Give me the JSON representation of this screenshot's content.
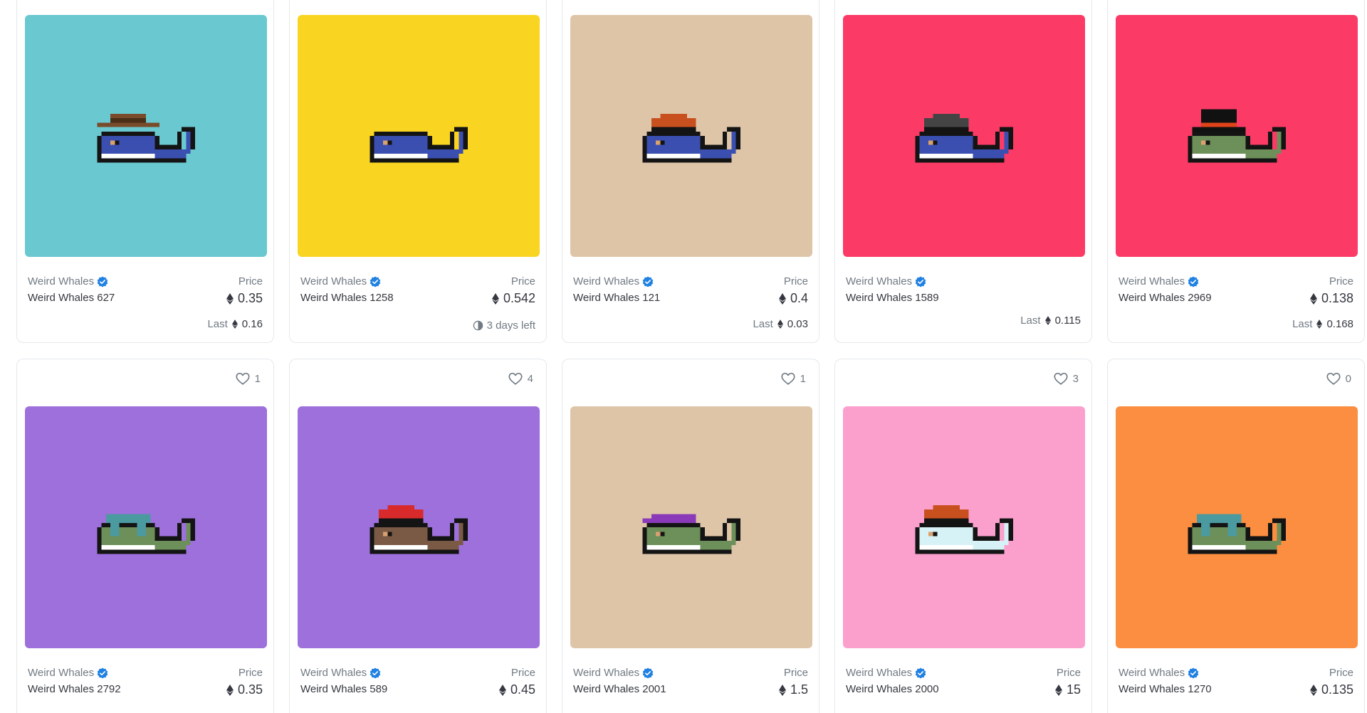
{
  "cards": [
    {
      "collection": "Weird Whales",
      "name": "Weird Whales 627",
      "price_label": "Price",
      "price": "0.35",
      "last_label": "Last",
      "last": "0.16",
      "bg": "#6ac8d0",
      "body": "#3a4fb0",
      "hat": "cowboy",
      "hat_color": "#7a4b2a"
    },
    {
      "collection": "Weird Whales",
      "name": "Weird Whales 1258",
      "price_label": "Price",
      "price": "0.542",
      "timer": "3 days left",
      "bg": "#f9d522",
      "body": "#3a4fb0",
      "hat": "none"
    },
    {
      "collection": "Weird Whales",
      "name": "Weird Whales 121",
      "price_label": "Price",
      "price": "0.4",
      "last_label": "Last",
      "last": "0.03",
      "bg": "#dec5a8",
      "body": "#3a4fb0",
      "hat": "beanie",
      "hat_color": "#c8501e"
    },
    {
      "collection": "Weird Whales",
      "name": "Weird Whales 1589",
      "price_label": "Price",
      "price": "",
      "last_label": "Last",
      "last": "0.115",
      "bg": "#fb3b66",
      "body": "#3a4fb0",
      "hat": "beanie",
      "hat_color": "#444444"
    },
    {
      "collection": "Weird Whales",
      "name": "Weird Whales 2969",
      "price_label": "Price",
      "price": "0.138",
      "last_label": "Last",
      "last": "0.168",
      "bg": "#fb3b66",
      "body": "#6d8f5a",
      "hat": "tophat",
      "hat_color": "#111111"
    },
    {
      "collection": "Weird Whales",
      "name": "Weird Whales 2792",
      "price_label": "Price",
      "price": "0.35",
      "likes": "1",
      "bg": "#9d70dc",
      "body": "#6d8f5a",
      "hat": "goggles",
      "hat_color": "#4a9aa0"
    },
    {
      "collection": "Weird Whales",
      "name": "Weird Whales 589",
      "price_label": "Price",
      "price": "0.45",
      "likes": "4",
      "bg": "#9d70dc",
      "body": "#7a5a45",
      "hat": "beanie",
      "hat_color": "#d82a2a"
    },
    {
      "collection": "Weird Whales",
      "name": "Weird Whales 2001",
      "price_label": "Price",
      "price": "1.5",
      "likes": "1",
      "bg": "#dec5a8",
      "body": "#6d8f5a",
      "hat": "cap",
      "hat_color": "#8a3ab8"
    },
    {
      "collection": "Weird Whales",
      "name": "Weird Whales 2000",
      "price_label": "Price",
      "price": "15",
      "likes": "3",
      "bg": "#fb9fcd",
      "body": "#d6f2f6",
      "hat": "beanie",
      "hat_color": "#c8501e"
    },
    {
      "collection": "Weird Whales",
      "name": "Weird Whales 1270",
      "price_label": "Price",
      "price": "0.135",
      "likes": "0",
      "bg": "#fb8e40",
      "body": "#6d8f5a",
      "hat": "goggles",
      "hat_color": "#4a9aa0"
    }
  ],
  "icons": {
    "currency": "eth-icon",
    "verified": "verified-badge-icon",
    "like": "heart-icon",
    "timer": "clock-icon"
  }
}
